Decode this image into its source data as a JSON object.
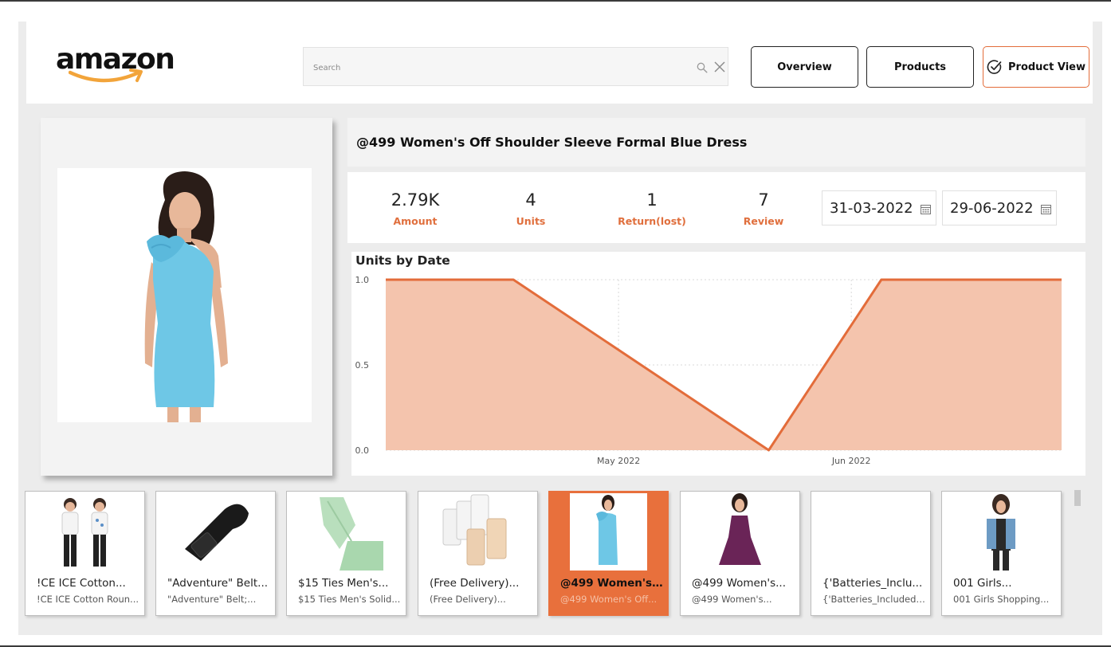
{
  "brand": {
    "logo_text": "amazon"
  },
  "search": {
    "placeholder": "Search",
    "value": ""
  },
  "nav": {
    "overview_label": "Overview",
    "products_label": "Products",
    "product_view_label": "Product View",
    "active": "Product View",
    "accent_color": "#e36c3a"
  },
  "product": {
    "title": "@499 Women's Off Shoulder Sleeve Formal Blue Dress",
    "image_icon": "blue-dress-photo"
  },
  "kpis": [
    {
      "value": "2.79K",
      "label": "Amount"
    },
    {
      "value": "4",
      "label": "Units"
    },
    {
      "value": "1",
      "label": "Return(lost)"
    },
    {
      "value": "7",
      "label": "Review"
    }
  ],
  "date_range": {
    "start": "31-03-2022",
    "end": "29-06-2022"
  },
  "chart_data": {
    "type": "area",
    "title": "Units by Date",
    "x": [
      "2022-03-31",
      "2022-04-17",
      "2022-05-04",
      "2022-05-21",
      "2022-06-05",
      "2022-06-29"
    ],
    "series": [
      {
        "values": [
          1.0,
          1.0,
          0.5,
          0.0,
          1.0,
          1.0
        ]
      }
    ],
    "y_ticks": [
      "0.0",
      "0.5",
      "1.0"
    ],
    "x_tick_labels": [
      "May 2022",
      "Jun 2022"
    ],
    "ylim": [
      0,
      1
    ],
    "grid": true,
    "line_color": "#e36c3a",
    "fill_color": "#f4c4ad"
  },
  "thumbnails": [
    {
      "title": "!CE ICE Cotton...",
      "subtitle": "!CE ICE Cotton Roun...",
      "icon": "kids-tshirt-photo",
      "active": false
    },
    {
      "title": "\"Adventure\" Belt...",
      "subtitle": "\"Adventure\" Belt;...",
      "icon": "belt-photo",
      "active": false
    },
    {
      "title": "$15 Ties Men's...",
      "subtitle": "$15 Ties Men's Solid...",
      "icon": "tie-photo",
      "active": false
    },
    {
      "title": "(Free Delivery)...",
      "subtitle": "(Free Delivery)...",
      "icon": "bra-extender-photo",
      "active": false
    },
    {
      "title": "@499 Women's...",
      "subtitle": "@499 Women's Off...",
      "icon": "blue-dress-photo",
      "active": true
    },
    {
      "title": "@499 Women's...",
      "subtitle": "@499 Women's...",
      "icon": "purple-dress-photo",
      "active": false
    },
    {
      "title": "{'Batteries_Inclu...",
      "subtitle": "{'Batteries_Included':...",
      "icon": "blank-photo",
      "active": false
    },
    {
      "title": "001 Girls...",
      "subtitle": "001 Girls Shopping...",
      "icon": "denim-vest-photo",
      "active": false
    }
  ]
}
